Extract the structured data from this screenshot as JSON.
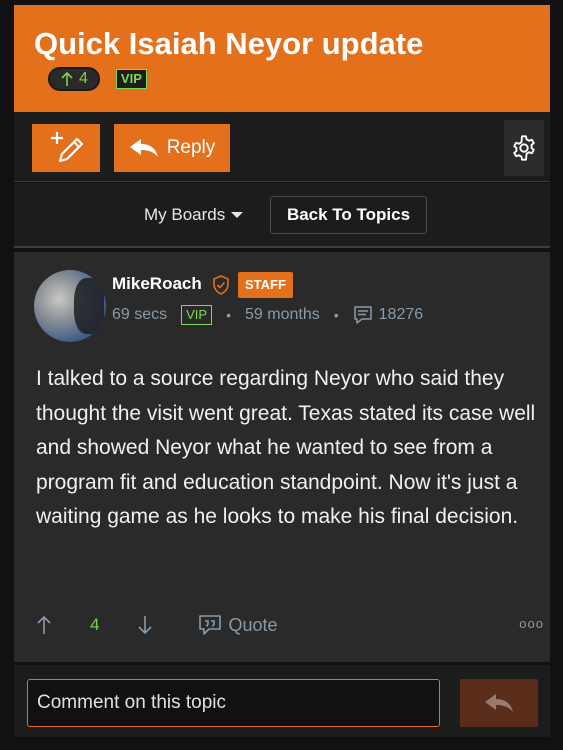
{
  "topic": {
    "title": "Quick Isaiah Neyor update",
    "vote_count": "4",
    "vip_label": "VIP"
  },
  "toolbar": {
    "reply_label": "Reply"
  },
  "nav": {
    "my_boards_label": "My Boards",
    "back_label": "Back To Topics"
  },
  "post": {
    "username": "MikeRoach",
    "staff_label": "STAFF",
    "time_ago": "69 secs",
    "vip_label": "VIP",
    "member_since": "59 months",
    "post_count": "18276",
    "body": "I talked to a source regarding Neyor who said they thought the visit went great. Texas stated its case well and showed Neyor what he wanted to see from a program fit and education standpoint. Now it's just a waiting game as he looks to make his final decision.",
    "votes": "4",
    "quote_label": "Quote",
    "more_label": "ooo"
  },
  "comment": {
    "placeholder": "Comment on this topic"
  },
  "colors": {
    "accent": "#e4701c",
    "vip_green": "#7ed957",
    "vote_green": "#7bd14a",
    "muted": "#8a9aa8"
  }
}
